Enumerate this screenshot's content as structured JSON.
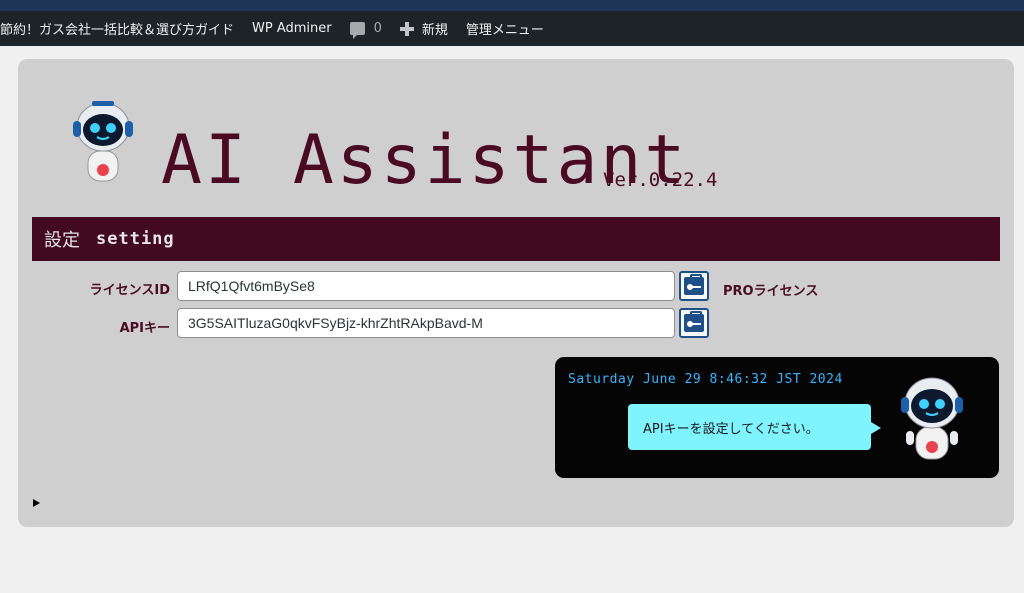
{
  "adminbar": {
    "site_name": "節約！ガス会社一括比較＆選び方ガイド",
    "wp_adminer": "WP Adminer",
    "comments_count": "0",
    "new_label": "新規",
    "admin_menu": "管理メニュー"
  },
  "header": {
    "title": "AI Assistant",
    "version": "Ver.0.22.4"
  },
  "settings": {
    "title_jp": "設定",
    "title_en": "setting",
    "license_label": "ライセンスID",
    "license_value": "LRfQ1Qfvt6mBySe8",
    "license_status": "PROライセンス",
    "api_label": "APIキー",
    "api_value": "3G5SAITluzaG0qkvFSyBjz-khrZhtRAkpBavd-M"
  },
  "chat": {
    "datetime": "Saturday June 29 8:46:32 JST 2024",
    "message": "APIキーを設定してください。"
  },
  "colors": {
    "accent": "#430a1f",
    "time_text": "#3ab4ff",
    "bubble": "#7ff4ff",
    "key_button": "#1e4f86"
  },
  "icons": [
    "robot-icon",
    "comment-bubble-icon",
    "plus-icon",
    "key-case-icon",
    "expand-triangle-icon"
  ]
}
